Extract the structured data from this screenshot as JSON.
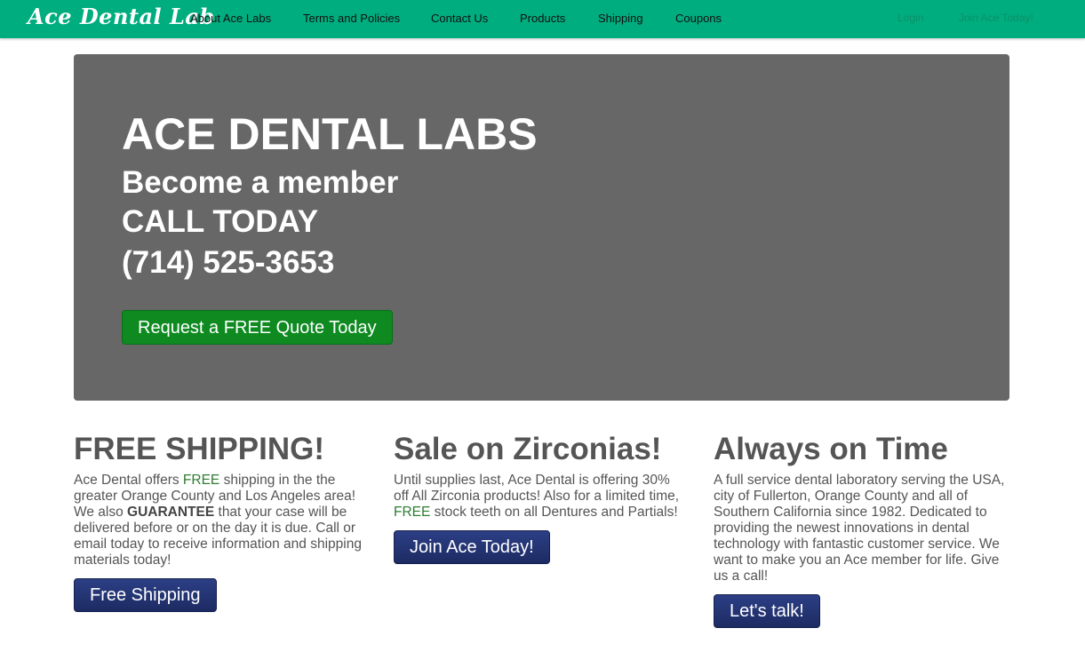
{
  "navbar": {
    "brand": "Ace Dental Lab",
    "links": [
      "About Ace Labs",
      "Terms and Policies",
      "Contact Us",
      "Products",
      "Shipping",
      "Coupons"
    ],
    "login": "Login",
    "join": "Join Ace Today!"
  },
  "hero": {
    "title": "ACE DENTAL LABS",
    "line1": "Become a member",
    "line2": "CALL TODAY",
    "phone": "(714) 525-3653",
    "button": "Request a FREE Quote Today"
  },
  "columns": [
    {
      "heading": "FREE SHIPPING!",
      "text_1": "Ace Dental offers ",
      "text_free": "FREE",
      "text_2": " shipping in the the greater Orange County and Los Angeles area! We also ",
      "text_strong": "GUARANTEE",
      "text_3": " that your case will be delivered before or on the day it is due. Call or email today to receive information and shipping materials today!",
      "button": "Free Shipping"
    },
    {
      "heading": "Sale on Zirconias!",
      "text_1": "Until supplies last, Ace Dental is offering 30% off All Zirconia products! Also for a limited time, ",
      "text_free": "FREE",
      "text_2": " stock teeth on all Dentures and Partials!",
      "button": "Join Ace Today!"
    },
    {
      "heading": "Always on Time",
      "text": "A full service dental laboratory serving the USA, city of Fullerton, Orange County and all of Southern California since 1982. Dedicated to providing the newest innovations in dental technology with fantastic customer service. We want to make you an Ace member for life. Give us a call!",
      "button": "Let's talk!"
    }
  ],
  "colors": {
    "navbar": "#00ad7f",
    "hero": "#666766",
    "quote_button": "#0e8a21",
    "action_button": "#24346f",
    "free_text": "#2e7d32"
  }
}
